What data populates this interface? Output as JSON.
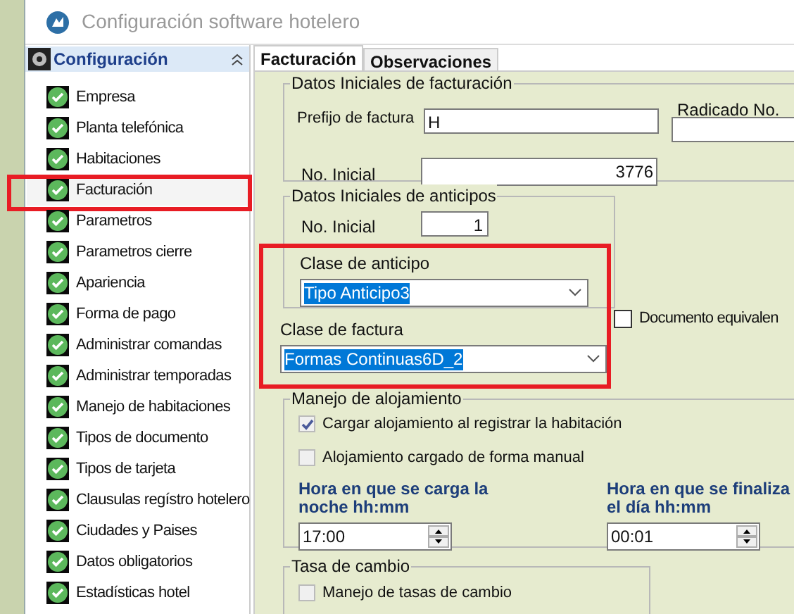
{
  "window": {
    "title": "Configuración software hotelero"
  },
  "sidebar": {
    "header": "Configuración",
    "items": [
      {
        "label": "Empresa",
        "selected": false
      },
      {
        "label": "Planta telefónica",
        "selected": false
      },
      {
        "label": "Habitaciones",
        "selected": false
      },
      {
        "label": "Facturación",
        "selected": true
      },
      {
        "label": "Parametros",
        "selected": false
      },
      {
        "label": "Parametros cierre",
        "selected": false
      },
      {
        "label": "Apariencia",
        "selected": false
      },
      {
        "label": "Forma de pago",
        "selected": false
      },
      {
        "label": "Administrar comandas",
        "selected": false
      },
      {
        "label": "Administrar temporadas",
        "selected": false
      },
      {
        "label": "Manejo de habitaciones",
        "selected": false
      },
      {
        "label": "Tipos de documento",
        "selected": false
      },
      {
        "label": "Tipos de tarjeta",
        "selected": false
      },
      {
        "label": "Clausulas regístro hotelero",
        "selected": false
      },
      {
        "label": "Ciudades y Paises",
        "selected": false
      },
      {
        "label": "Datos obligatorios",
        "selected": false
      },
      {
        "label": "Estadísticas hotel",
        "selected": false
      }
    ]
  },
  "tabs": [
    {
      "label": "Facturación",
      "selected": true
    },
    {
      "label": "Observaciones",
      "selected": false
    }
  ],
  "billing": {
    "title": "Datos Iniciales de facturación",
    "prefix_label": "Prefijo de factura",
    "prefix_value": "H",
    "radicado_label": "Radicado No.",
    "initial_label": "No. Inicial",
    "initial_value": "3776"
  },
  "advances": {
    "title": "Datos Iniciales de anticipos",
    "initial_label": "No. Inicial",
    "initial_value": "1",
    "class_label": "Clase de anticipo",
    "class_value": "Tipo Anticipo3"
  },
  "equivalent_document": {
    "label": "Documento equivalen",
    "checked": false
  },
  "invoice_class": {
    "label": "Clase de factura",
    "value": "Formas Continuas6D_2"
  },
  "lodging": {
    "title": "Manejo de alojamiento",
    "options": [
      {
        "label": "Cargar alojamiento al registrar la habitación",
        "checked": true
      },
      {
        "label": "Alojamiento cargado de forma manual",
        "checked": false
      }
    ],
    "times": [
      {
        "label": "Hora en que se carga la noche hh:mm",
        "value": "17:00"
      },
      {
        "label": "Hora en que se  finaliza el día hh:mm",
        "value": "00:01"
      }
    ]
  },
  "exchange": {
    "title": "Tasa de cambio",
    "option": {
      "label": "Manejo de tasas de cambio",
      "checked": false
    }
  }
}
